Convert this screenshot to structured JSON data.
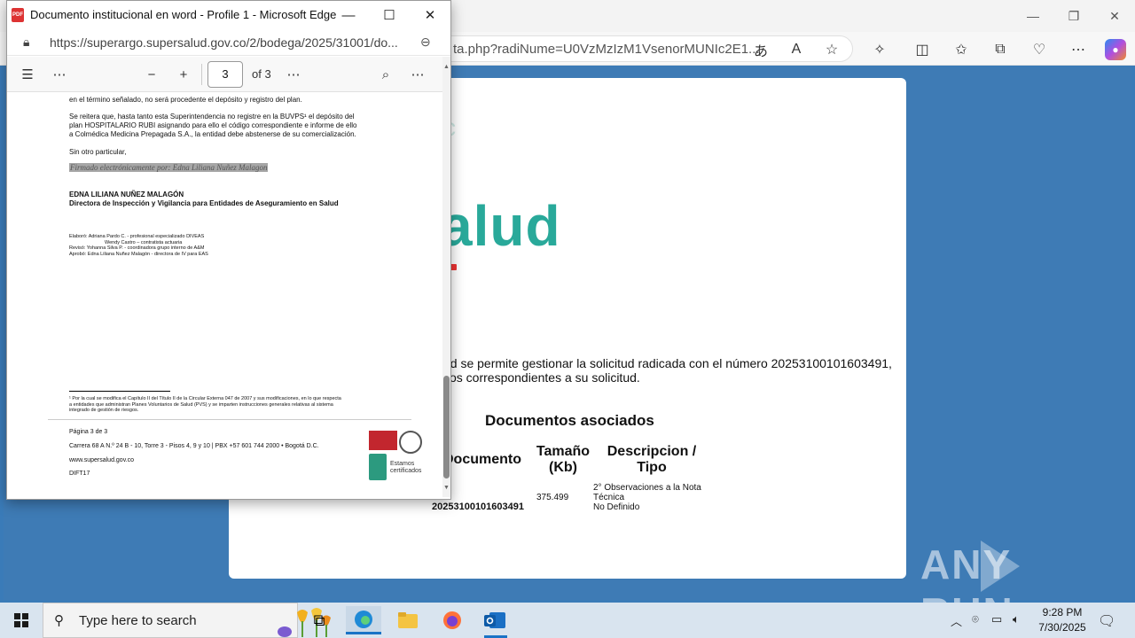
{
  "bg_window": {
    "url": "ta.php?radiNume=U0VzMzIzM1VsenorMUNIc2E1...",
    "controls": {
      "minimize": "—",
      "restore": "❐",
      "close": "✕"
    }
  },
  "bg_page": {
    "logo_word": "alud",
    "logo_hint": "c",
    "message_line1": "ud se permite gestionar la solicitud radicada con el número 20253100101603491,",
    "message_line2": "vos correspondientes a su solicitud.",
    "docs_title": "Documentos asociados",
    "col_documento": "Documento",
    "col_tamano_1": "Tamaño",
    "col_tamano_2": "(Kb)",
    "col_desc_1": "Descripcion /",
    "col_desc_2": "Tipo",
    "row_numero": "20253100101603491",
    "row_tamano": "375.499",
    "row_desc_1": "2° Observaciones a la Nota",
    "row_desc_2": "Técnica",
    "row_tipo": "No Definido"
  },
  "watermark": {
    "left": "ANY",
    "right": "RUN"
  },
  "pdf_window": {
    "title": "Documento institucional en word - Profile 1 - Microsoft Edge",
    "icon_label": "PDF",
    "url": "https://superargo.supersalud.gov.co/2/bodega/2025/31001/do...",
    "controls": {
      "minimize": "—",
      "maximize": "☐",
      "close": "✕"
    },
    "toolbar": {
      "current_page": "3",
      "of_pages": "of 3"
    }
  },
  "pdf_doc": {
    "line_top": "en el término señalado, no será procedente el depósito y registro del plan.",
    "para1_l1": "Se reitera que, hasta tanto esta Superintendencia no registre en la BUVPS¹ el depósito del",
    "para1_l2": "plan HOSPITALARIO RUBI asignando para ello el código correspondiente e informe de ello",
    "para1_l3": "a Colmédica Medicina Prepagada S.A., la entidad debe abstenerse de su comercialización.",
    "closing": "Sin otro particular,",
    "signature": "Firmado electrónicamente por: Edna Liliana Nuñez Malagon",
    "signer_name": "EDNA LILIANA NUÑEZ MALAGÓN",
    "signer_title": "Directora de Inspección y Vigilancia para Entidades de Aseguramiento en Salud",
    "elaboro_1": "Elaboró: Adriana Pardo C. - profesional especializado DIVEAS",
    "elaboro_2": "Wendy Castro – contratista actuaria",
    "reviso": "Revisó: Yohanna Silva P. - coordinadora grupo interno de A&M",
    "aprobo": "Aprobó: Edna Liliana Nuñez Malagón - directora de IV para EAS",
    "footnote_1": "¹ Por la cual se modifica el Capítulo II del Título II de la Circular Externa 047 de 2007 y sus modificaciones, en lo que respecta",
    "footnote_2": "a entidades que administran Planes Voluntarios de Salud (PVS) y se imparten instrucciones generales relativas al sistema",
    "footnote_3": "integrado de gestión de riesgos.",
    "page_label": "Página 3 de 3",
    "address": "Carrera 68 A N.º 24 B - 10, Torre 3 - Pisos 4, 9 y 10 | PBX +57 601 744 2000 • Bogotá D.C.",
    "website": "www.supersalud.gov.co",
    "code": "DIFT17",
    "cert_text_1": "Estamos",
    "cert_text_2": "certificados"
  },
  "taskbar": {
    "search_placeholder": "Type here to search",
    "time": "9:28 PM",
    "date": "7/30/2025"
  }
}
